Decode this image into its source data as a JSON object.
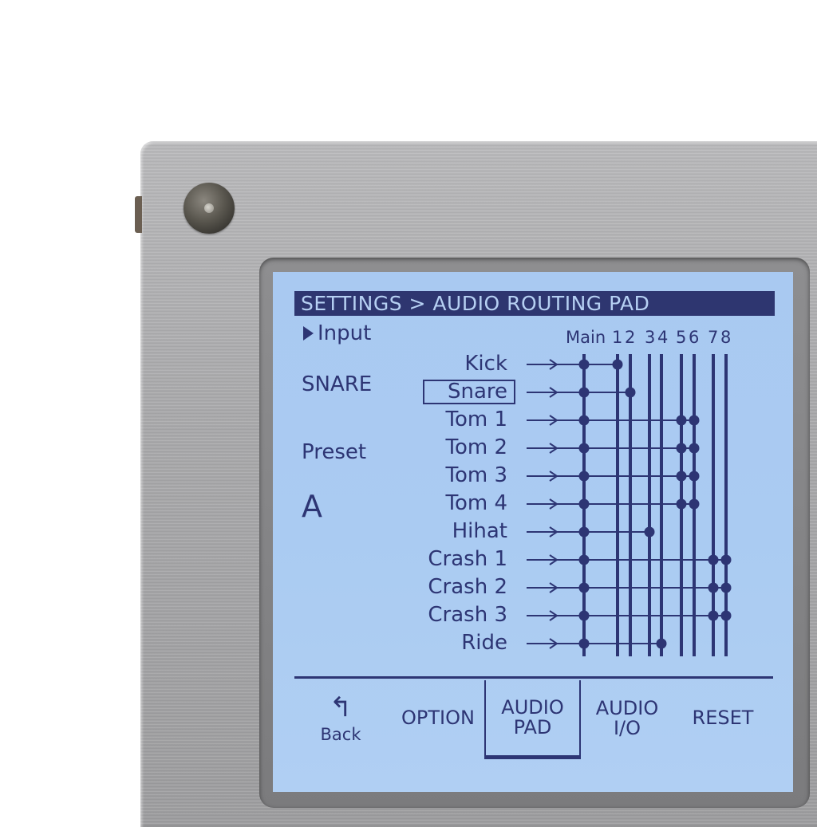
{
  "breadcrumb": "SETTINGS > AUDIO ROUTING PAD",
  "sidebar": {
    "input_label": "Input",
    "input_value": "SNARE",
    "preset_label": "Preset",
    "preset_value": "A"
  },
  "bus_labels": [
    "Main",
    "1",
    "2",
    "3",
    "4",
    "5",
    "6",
    "7",
    "8"
  ],
  "instruments": [
    "Kick",
    "Snare",
    "Tom 1",
    "Tom 2",
    "Tom 3",
    "Tom 4",
    "Hihat",
    "Crash 1",
    "Crash 2",
    "Crash 3",
    "Ride"
  ],
  "selected_instrument": "Snare",
  "routing": {
    "Kick": [
      "Main",
      "1"
    ],
    "Snare": [
      "Main",
      "2"
    ],
    "Tom 1": [
      "Main",
      "5",
      "6"
    ],
    "Tom 2": [
      "Main",
      "5",
      "6"
    ],
    "Tom 3": [
      "Main",
      "5",
      "6"
    ],
    "Tom 4": [
      "Main",
      "5",
      "6"
    ],
    "Hihat": [
      "Main",
      "3"
    ],
    "Crash 1": [
      "Main",
      "7",
      "8"
    ],
    "Crash 2": [
      "Main",
      "7",
      "8"
    ],
    "Crash 3": [
      "Main",
      "7",
      "8"
    ],
    "Ride": [
      "Main",
      "4"
    ]
  },
  "buttons": {
    "back": "Back",
    "option": "OPTION",
    "audio_pad_line1": "AUDIO",
    "audio_pad_line2": "PAD",
    "audio_io_line1": "AUDIO",
    "audio_io_line2": "I/O",
    "reset": "RESET"
  },
  "colors": {
    "lcd_background": "#aacbf2",
    "lcd_ink": "#2d3574",
    "panel_metal": "#a9a9ab"
  }
}
